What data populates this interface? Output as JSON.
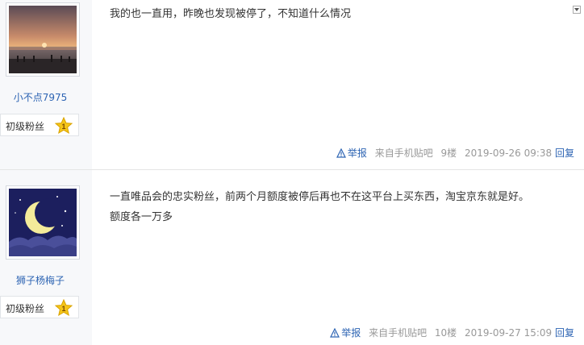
{
  "posts": [
    {
      "user": {
        "name": "小不点7975",
        "level_label": "初级粉丝",
        "level": "1",
        "avatar": "sunset-avatar"
      },
      "content_lines": [
        "我的也一直用，昨晚也发现被停了，不知道什么情况"
      ],
      "meta": {
        "report": "举报",
        "source": "来自手机贴吧",
        "floor": "9楼",
        "time": "2019-09-26 09:38",
        "reply": "回复"
      }
    },
    {
      "user": {
        "name": "狮子杨梅子",
        "level_label": "初级粉丝",
        "level": "1",
        "avatar": "moon-avatar"
      },
      "content_lines": [
        "一直唯品会的忠实粉丝，前两个月额度被停后再也不在这平台上买东西，淘宝京东就是好。",
        "额度各一万多"
      ],
      "meta": {
        "report": "举报",
        "source": "来自手机贴吧",
        "floor": "10楼",
        "time": "2019-09-27 15:09",
        "reply": "回复"
      }
    }
  ],
  "colors": {
    "link": "#2d64b3",
    "meta": "#999999",
    "sidebar_bg": "#f7f8fa",
    "star": "#f5c518"
  }
}
